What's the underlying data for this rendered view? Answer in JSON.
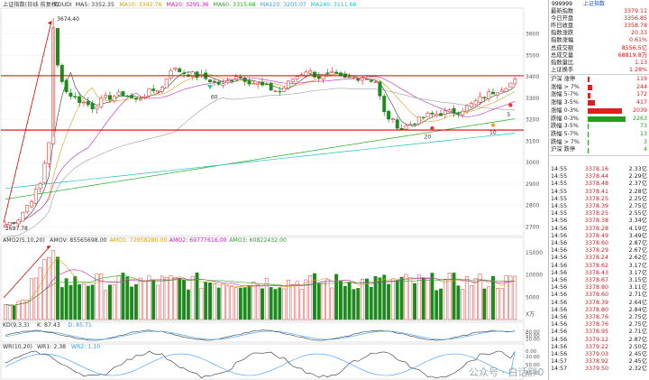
{
  "main": {
    "title": "上证指数(日线 前复权)",
    "ma_labels": [
      {
        "text": "KOUDI",
        "color": "#333333"
      },
      {
        "text": "MA5: 3352.35",
        "color": "#333333"
      },
      {
        "text": "MA10: 3342.76",
        "color": "#d4a017"
      },
      {
        "text": "MA20: 3295.36",
        "color": "#c020c0"
      },
      {
        "text": "MA60: 3315.68",
        "color": "#22aa22"
      },
      {
        "text": "MA120: 3205.07",
        "color": "#3399ff"
      },
      {
        "text": "MA240: 3111.66",
        "color": "#20c0c0"
      }
    ],
    "y_ticks": [
      "3600",
      "3500",
      "3400",
      "3300",
      "3200",
      "3100",
      "3000",
      "2900",
      "2800",
      "2700"
    ],
    "high_label": "3674.40",
    "low_label": "2697.78",
    "marks": [
      "60",
      "20",
      "10",
      "5"
    ],
    "hlines": [
      3405,
      3152
    ]
  },
  "volume": {
    "labels": [
      {
        "text": "AMO2(5,10,20)",
        "color": "#333333"
      },
      {
        "text": "AMOV: 85565698.00",
        "color": "#333333"
      },
      {
        "text": "AMO1: 72958280.00",
        "color": "#d4a017"
      },
      {
        "text": "AMO2: 69777616.00",
        "color": "#c020c0"
      },
      {
        "text": "AMO3: 60822432.00",
        "color": "#22aa22"
      }
    ],
    "y_ticks": [
      "15000",
      "10000",
      "5000"
    ],
    "unit": "X万"
  },
  "kdj": {
    "labels": [
      {
        "text": "KD(9,3,3)",
        "color": "#333333"
      },
      {
        "text": "K: 87.43",
        "color": "#333333"
      },
      {
        "text": "D: 85.71",
        "color": "#3399ff"
      }
    ],
    "y_ticks": [
      "80.00",
      "50.00",
      "20.00"
    ]
  },
  "wr": {
    "labels": [
      {
        "text": "WR(10,20)",
        "color": "#333333"
      },
      {
        "text": "WR1: 2.38",
        "color": "#333333"
      },
      {
        "text": "WR2: 1.10",
        "color": "#3399ff"
      }
    ],
    "y_ticks": [
      "0.00",
      "20.00",
      "50.00",
      "80.00"
    ]
  },
  "sidebar": {
    "header_code": "999999",
    "header_name": "上证指数",
    "quote": [
      {
        "k": "最新指数",
        "v": "3379.11"
      },
      {
        "k": "今日开盘",
        "v": "3356.85"
      },
      {
        "k": "昨日收盘",
        "v": "3358.78"
      },
      {
        "k": "指数涨跌",
        "v": "20.33"
      },
      {
        "k": "指数涨幅",
        "v": "0.61%"
      },
      {
        "k": "总成交额",
        "v": "8556.5亿"
      },
      {
        "k": "总成交量",
        "v": "68819.8万"
      },
      {
        "k": "指数量比",
        "v": "1.13"
      },
      {
        "k": "上证换手",
        "v": "1.28%"
      }
    ],
    "breadth": [
      {
        "k": "沪深 涨停",
        "v": "119",
        "bar": 0.05,
        "color": "#e02020"
      },
      {
        "k": "涨幅 > 7%",
        "v": "244",
        "bar": 0.1,
        "color": "#e02020"
      },
      {
        "k": "涨幅 5-7%",
        "v": "172",
        "bar": 0.07,
        "color": "#e02020"
      },
      {
        "k": "涨幅 3-5%",
        "v": "417",
        "bar": 0.16,
        "color": "#e02020"
      },
      {
        "k": "涨幅 0-3%",
        "v": "2039",
        "bar": 0.8,
        "color": "#e02020"
      },
      {
        "k": "跌幅 0-3%",
        "v": "2263",
        "bar": 0.88,
        "color": "#22a022"
      },
      {
        "k": "跌幅 3-5%",
        "v": "73",
        "bar": 0.03,
        "color": "#22a022"
      },
      {
        "k": "跌幅 5-7%",
        "v": "13",
        "bar": 0.01,
        "color": "#22a022"
      },
      {
        "k": "跌幅 > 7%",
        "v": "3",
        "bar": 0.005,
        "color": "#22a022"
      },
      {
        "k": "沪深 跌停",
        "v": "4",
        "bar": 0.005,
        "color": "#22a022"
      }
    ],
    "ticks": [
      {
        "t": "14:55",
        "p": "3378.16",
        "q": "2.33亿"
      },
      {
        "t": "14:55",
        "p": "3378.44",
        "q": "2.29亿"
      },
      {
        "t": "14:55",
        "p": "3378.48",
        "q": "2.37亿"
      },
      {
        "t": "14:55",
        "p": "3378.41",
        "q": "2.28亿"
      },
      {
        "t": "14:55",
        "p": "3378.25",
        "q": "2.25亿"
      },
      {
        "t": "14:55",
        "p": "3378.39",
        "q": "2.75亿"
      },
      {
        "t": "14:55",
        "p": "3378.25",
        "q": "2.55亿"
      },
      {
        "t": "14:56",
        "p": "3378.38",
        "q": "3.34亿"
      },
      {
        "t": "14:56",
        "p": "3378.28",
        "q": "4.19亿"
      },
      {
        "t": "14:56",
        "p": "3378.49",
        "q": "3.49亿"
      },
      {
        "t": "14:56",
        "p": "3378.60",
        "q": "2.87亿"
      },
      {
        "t": "14:56",
        "p": "3378.29",
        "q": "2.67亿"
      },
      {
        "t": "14:56",
        "p": "3378.24",
        "q": "2.62亿"
      },
      {
        "t": "14:56",
        "p": "3378.62",
        "q": "3.17亿"
      },
      {
        "t": "14:56",
        "p": "3378.43",
        "q": "3.17亿"
      },
      {
        "t": "14:56",
        "p": "3378.67",
        "q": "3.15亿"
      },
      {
        "t": "14:56",
        "p": "3378.80",
        "q": "3.11亿"
      },
      {
        "t": "14:56",
        "p": "3378.60",
        "q": "2.71亿"
      },
      {
        "t": "14:56",
        "p": "3378.39",
        "q": "2.64亿"
      },
      {
        "t": "14:56",
        "p": "3378.80",
        "q": "2.84亿"
      },
      {
        "t": "14:56",
        "p": "3378.76",
        "q": "2.75亿"
      },
      {
        "t": "14:56",
        "p": "3378.76",
        "q": "2.75亿"
      },
      {
        "t": "14:56",
        "p": "3378.95",
        "q": "2.71亿"
      },
      {
        "t": "14:56",
        "p": "3379.12",
        "q": "2.87亿"
      },
      {
        "t": "14:56",
        "p": "3379.22",
        "q": "2.50亿"
      },
      {
        "t": "14:56",
        "p": "3379.03",
        "q": "2.45亿"
      },
      {
        "t": "14:57",
        "p": "3378.92",
        "q": "2.45亿"
      },
      {
        "t": "14:57",
        "p": "3379.50",
        "q": "2.32亿"
      }
    ]
  },
  "watermark": "公众号 · 白话胖0"
}
